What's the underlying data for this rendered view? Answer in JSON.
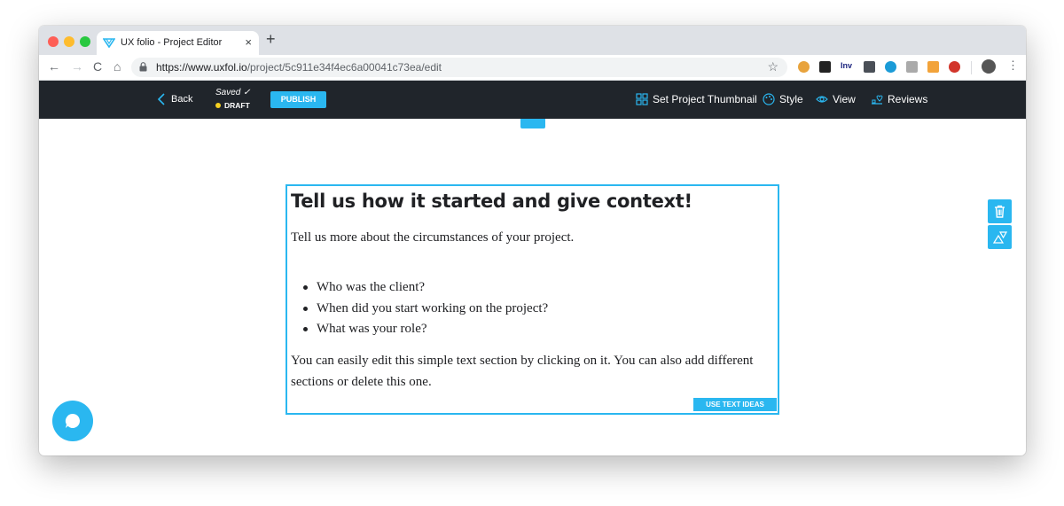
{
  "browser": {
    "tab_title": "UX folio - Project Editor",
    "tab_close": "×",
    "new_tab": "+",
    "url_domain": "https://www.uxfol.io",
    "url_path": "/project/5c911e34f4ec6a00041c73ea/edit",
    "ext_inv_label": "Inv"
  },
  "header": {
    "back_label": "Back",
    "saved_label": "Saved ✓",
    "draft_label": "DRAFT",
    "publish_label": "PUBLISH",
    "thumbnail_label": "Set Project Thumbnail",
    "style_label": "Style",
    "view_label": "View",
    "reviews_label": "Reviews"
  },
  "section": {
    "title": "Tell us how it started and give context!",
    "intro": "Tell us more about the circumstances of your project.",
    "bullets": [
      "Who was the client?",
      "When did you start working on the project?",
      "What was your role?"
    ],
    "body": "You can easily edit this simple text section by clicking on it. You can also add different sections or delete this one.",
    "use_text_ideas_label": "USE TEXT IDEAS"
  },
  "colors": {
    "accent": "#2ab7f0",
    "header_bg": "#20252b",
    "draft_dot": "#f5d020"
  },
  "icons": [
    "back-chevron-icon",
    "thumbnail-grid-icon",
    "palette-icon",
    "eye-icon",
    "reviews-icon",
    "trash-icon",
    "shapes-icon",
    "chat-icon",
    "lock-icon",
    "star-icon"
  ]
}
